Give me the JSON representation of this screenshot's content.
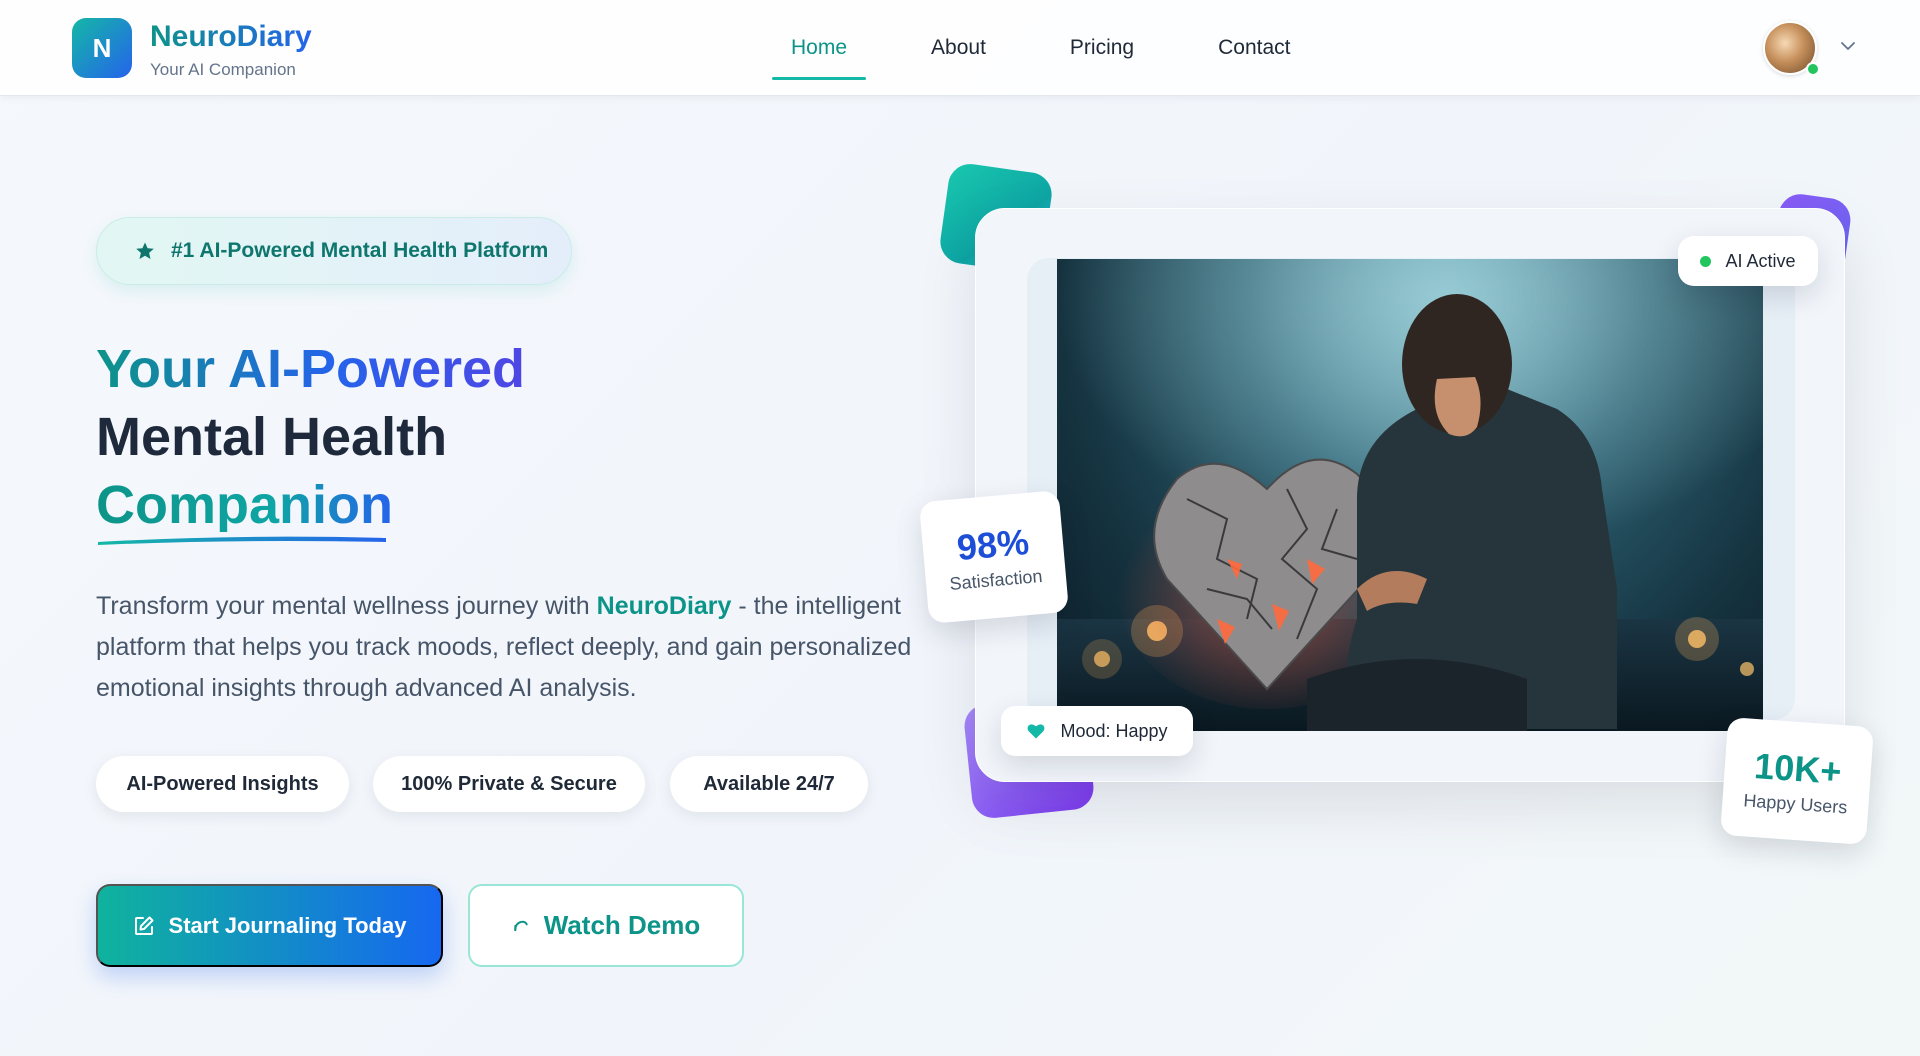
{
  "header": {
    "logo_letter": "N",
    "brand_name": "NeuroDiary",
    "brand_tagline": "Your AI Companion",
    "nav": [
      {
        "label": "Home",
        "active": true
      },
      {
        "label": "About",
        "active": false
      },
      {
        "label": "Pricing",
        "active": false
      },
      {
        "label": "Contact",
        "active": false
      }
    ],
    "user_menu_icon": "chevron-down-icon"
  },
  "hero": {
    "badge": {
      "icon": "star-icon",
      "text": "#1 AI-Powered Mental Health Platform"
    },
    "headline": {
      "line1": "Your AI-Powered",
      "line2": "Mental Health",
      "line3": "Companion"
    },
    "description": {
      "before": "Transform your mental wellness journey with ",
      "highlight": "NeuroDiary",
      "after": " - the intelligent platform that helps you track moods, reflect deeply, and gain personalized emotional insights through advanced AI analysis."
    },
    "features": [
      "AI-Powered Insights",
      "100% Private & Secure",
      "Available 24/7"
    ],
    "primary_cta": {
      "icon": "edit-icon",
      "label": "Start Journaling Today"
    },
    "secondary_cta": {
      "icon": "play-icon",
      "label": "Watch Demo"
    }
  },
  "showcase": {
    "status": {
      "text": "AI Active",
      "color": "#22c55e"
    },
    "satisfaction": {
      "value": "98%",
      "label": "Satisfaction"
    },
    "mood": {
      "icon": "heart-icon",
      "text": "Mood: Happy"
    },
    "users": {
      "value": "10K+",
      "label": "Happy Users"
    }
  },
  "colors": {
    "brand_teal": "#0d9488",
    "brand_blue": "#2563eb",
    "accent_violet": "#8b5cf6",
    "online_green": "#22c55e"
  }
}
